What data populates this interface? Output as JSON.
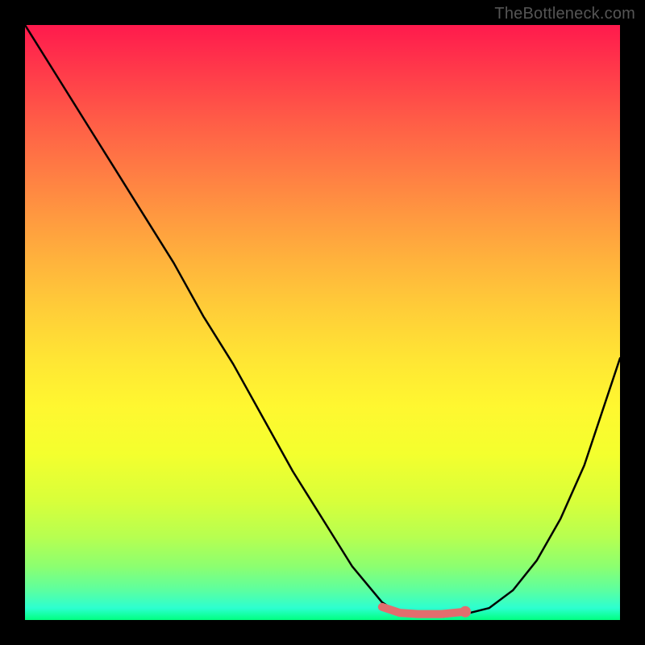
{
  "watermark": "TheBottleneck.com",
  "colors": {
    "curve_stroke": "#000000",
    "valley_stroke": "#e26e6e",
    "gradient_top": "#ff1a4d",
    "gradient_bottom": "#00ff80"
  },
  "chart_data": {
    "type": "line",
    "title": "",
    "xlabel": "",
    "ylabel": "",
    "xlim": [
      0,
      100
    ],
    "ylim": [
      0,
      100
    ],
    "grid": false,
    "legend": false,
    "series": [
      {
        "name": "bottleneck-curve",
        "x": [
          0,
          5,
          10,
          15,
          20,
          25,
          30,
          35,
          40,
          45,
          50,
          55,
          60,
          63,
          66,
          70,
          74,
          78,
          82,
          86,
          90,
          94,
          100
        ],
        "values": [
          100,
          92,
          84,
          76,
          68,
          60,
          51,
          43,
          34,
          25,
          17,
          9,
          3,
          1,
          0.5,
          0.5,
          1,
          2,
          5,
          10,
          17,
          26,
          44
        ]
      }
    ],
    "valley_highlight": {
      "name": "optimal-range",
      "x": [
        60,
        63,
        66,
        70,
        74
      ],
      "values": [
        2.2,
        1.2,
        1.0,
        1.0,
        1.4
      ]
    },
    "valley_dot": {
      "x": 74,
      "value": 1.4
    }
  }
}
